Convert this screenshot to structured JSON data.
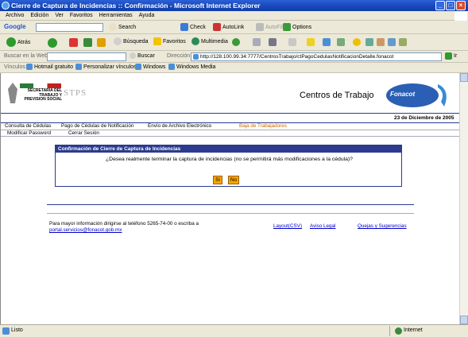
{
  "window": {
    "title": "Cierre de Captura de Incidencias :: Confirmación - Microsoft Internet Explorer"
  },
  "menu": [
    "Archivo",
    "Edición",
    "Ver",
    "Favoritos",
    "Herramientas",
    "Ayuda"
  ],
  "google": {
    "logo": "Google",
    "search_label": "Search",
    "check_label": "Check",
    "autolink_label": "AutoLink",
    "autofill_label": "AutoFill",
    "options_label": "Options"
  },
  "nav": {
    "back_label": "Atrás",
    "search_label": "Búsqueda",
    "favorites_label": "Favoritos",
    "media_label": "Multimedia"
  },
  "address": {
    "search_web_label": "Buscar en la Web",
    "search_btn": "Buscar",
    "label": "Dirección",
    "url": "http://128.100.99.34:7777/CentrosTrabajo/ctPagoCedulasNotificacionDetalle.fonacot",
    "go_label": "Ir"
  },
  "links": {
    "label": "Vínculos",
    "items": [
      "Hotmail gratuito",
      "Personalizar vínculos",
      "Windows",
      "Windows Media"
    ]
  },
  "page": {
    "logo_text": [
      "SECRETARIA DEL",
      "TRABAJO Y",
      "PREVISION SOCIAL"
    ],
    "logo_stps": "STPS",
    "header_title": "Centros de Trabajo",
    "fonacot_logo": "Fonacot",
    "date": "23 de Diciembre de 2005",
    "nav_row1": [
      "Consulta de Cédulas",
      "Pago de Cédulas de Notificación",
      "Envío de Archivo Electrónico",
      "Baja de Trabajadores"
    ],
    "nav_row2": [
      "Modificar Password",
      "Cerrar Sesión"
    ],
    "dialog_title": "Confirmación de Cierre de Captura de Incidencias",
    "dialog_question": "¿Desea realmente terminar la captura de incidencias (no se permitirá más modificaciones a la cédula)?",
    "yes_label": "Si",
    "no_label": "No",
    "footer_text": "Para mayor información dirigirse al teléfono 5265-74-00 o escriba a",
    "footer_email": "portal.servicios@fonacot.gob.mx",
    "footer_layout": "Layout(CSV)",
    "footer_legal": "Aviso Legal",
    "footer_complaints": "Quejas y Sugerencias"
  },
  "status": {
    "text": "Listo",
    "zone": "Internet"
  },
  "colors": {
    "accent": "#2c3b8f",
    "button": "#f7a400",
    "nav_orange": "#cc6600"
  }
}
